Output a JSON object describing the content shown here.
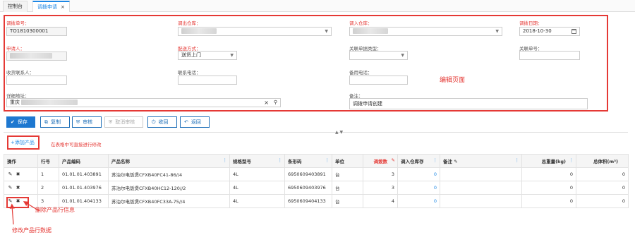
{
  "tabs": [
    {
      "label": "控制台"
    },
    {
      "label": "调拨申请",
      "close": "×"
    }
  ],
  "form": {
    "order_no": {
      "label": "调拨单号：",
      "value": "TO1810300001"
    },
    "out_warehouse": {
      "label": "调出仓库："
    },
    "in_warehouse": {
      "label": "调入仓库："
    },
    "transfer_date": {
      "label": "调拨日期：",
      "value": "2018-10-30"
    },
    "applicant": {
      "label": "申请人："
    },
    "delivery_method": {
      "label": "配送方式：",
      "value": "送货上门"
    },
    "related_type": {
      "label": "关联单据类型："
    },
    "related_no": {
      "label": "关联单号："
    },
    "receiver": {
      "label": "收货联系人："
    },
    "phone": {
      "label": "联系电话："
    },
    "backup_phone": {
      "label": "备用电话："
    },
    "address": {
      "label": "详细地址：",
      "value_prefix": "重庆"
    },
    "remark": {
      "label": "备注：",
      "value": "调拨申请创建"
    },
    "edit_note": "编辑页面"
  },
  "toolbar": {
    "save": "保存",
    "copy": "复制",
    "audit": "审核",
    "cancel_audit": "取消审核",
    "recall": "收回",
    "back": "返回"
  },
  "product": {
    "add_label": "+添加产品",
    "tip": "在表格中可直接进行修改"
  },
  "table": {
    "headers": {
      "op": "操作",
      "row": "行号",
      "code": "产品编码",
      "name": "产品名称",
      "spec": "规格型号",
      "barcode": "条形码",
      "unit": "单位",
      "qty": "调拨数",
      "stock": "调入仓库存",
      "remark": "备注",
      "weight": "总重量(kg)",
      "volume": "总体积(m³)"
    },
    "rows": [
      {
        "row": "1",
        "code": "01.01.01.403891",
        "name": "苏泊尔电饭煲CFXB40FC41-86//4",
        "spec": "4L",
        "barcode": "6950609403891",
        "unit": "台",
        "qty": "3",
        "stock": "0",
        "remark": "",
        "weight": "0",
        "volume": "0"
      },
      {
        "row": "2",
        "code": "01.01.01.403976",
        "name": "苏泊尔电饭煲CFXB40HC12-120//2",
        "spec": "4L",
        "barcode": "6950609403976",
        "unit": "台",
        "qty": "3",
        "stock": "0",
        "remark": "",
        "weight": "0",
        "volume": "0"
      },
      {
        "row": "3",
        "code": "01.01.01.404133",
        "name": "苏泊尔电饭煲CFXB40FC33A-75//4",
        "spec": "4L",
        "barcode": "6950609404133",
        "unit": "台",
        "qty": "4",
        "stock": "0",
        "remark": "",
        "weight": "0",
        "volume": "0"
      }
    ]
  },
  "annotations": {
    "delete_row": "删除产品行信息",
    "edit_row": "修改产品行数据"
  },
  "colors": {
    "accent": "#1e78d0",
    "annotation": "#e53935"
  },
  "icons": [
    "pencil-icon",
    "close-icon",
    "calendar-icon",
    "search-icon",
    "chevron-down-icon",
    "check-icon",
    "copy-icon",
    "shield-icon",
    "power-icon",
    "undo-icon",
    "column-menu-icon"
  ]
}
